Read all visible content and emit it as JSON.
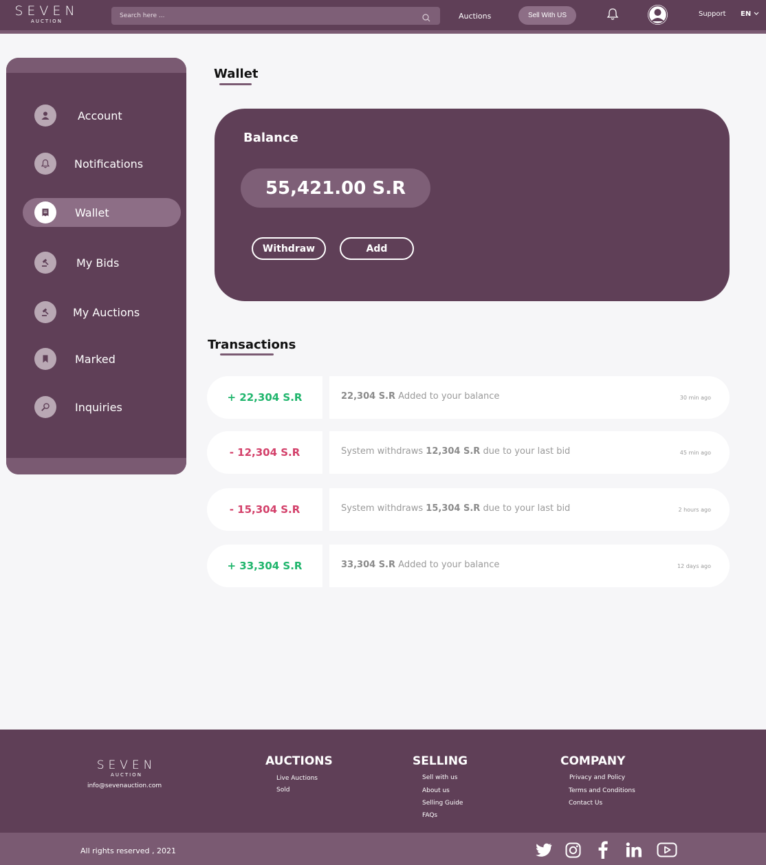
{
  "brand": {
    "name": "SEVEN",
    "tagline": "AUCTION"
  },
  "header": {
    "search_placeholder": "Search here ...",
    "nav_auctions": "Auctions",
    "sell_button": "Sell With US",
    "support": "Support",
    "language": "EN"
  },
  "sidebar": {
    "items": [
      {
        "label": "Account",
        "icon": "user-icon"
      },
      {
        "label": "Notifications",
        "icon": "bell-icon"
      },
      {
        "label": "Wallet",
        "icon": "wallet-icon",
        "active": true
      },
      {
        "label": "My Bids",
        "icon": "gavel-icon"
      },
      {
        "label": "My Auctions",
        "icon": "gavel-icon"
      },
      {
        "label": "Marked",
        "icon": "bookmark-icon"
      },
      {
        "label": "Inquiries",
        "icon": "search-icon"
      }
    ]
  },
  "wallet": {
    "title": "Wallet",
    "balance_label": "Balance",
    "balance_value": "55,421.00 S.R",
    "withdraw_label": "Withdraw",
    "add_label": "Add"
  },
  "transactions": {
    "title": "Transactions",
    "items": [
      {
        "amount": "+ 22,304 S.R",
        "type": "credit",
        "pre": "",
        "bold": "22,304 S.R",
        "post": " Added to your balance",
        "time": "30 min ago"
      },
      {
        "amount": "- 12,304 S.R",
        "type": "debit",
        "pre": "System withdraws ",
        "bold": "12,304 S.R",
        "post": " due to your last bid",
        "time": "45 min ago"
      },
      {
        "amount": "- 15,304 S.R",
        "type": "debit",
        "pre": "System withdraws ",
        "bold": "15,304 S.R",
        "post": " due to your last bid",
        "time": "2 hours ago"
      },
      {
        "amount": "+ 33,304 S.R",
        "type": "credit",
        "pre": "",
        "bold": "33,304 S.R",
        "post": " Added to your balance",
        "time": "12 days ago"
      }
    ]
  },
  "footer": {
    "email": "info@sevenauction.com",
    "columns": [
      {
        "heading": "AUCTIONS",
        "links": [
          "Live Auctions",
          "Sold"
        ]
      },
      {
        "heading": "SELLING",
        "links": [
          "Sell with us",
          "About us",
          "Selling Guide",
          "FAQs"
        ]
      },
      {
        "heading": "COMPANY",
        "links": [
          "Privacy and Policy",
          "Terms and Conditions",
          "Contact Us"
        ]
      }
    ],
    "copyright": "All  rights reserved , 2021",
    "social": [
      "twitter-icon",
      "instagram-icon",
      "facebook-icon",
      "linkedin-icon",
      "youtube-icon"
    ]
  },
  "colors": {
    "primary": "#5f3f57",
    "primary_light": "#7a5a72",
    "credit": "#1fb56c",
    "debit": "#d3406a"
  }
}
